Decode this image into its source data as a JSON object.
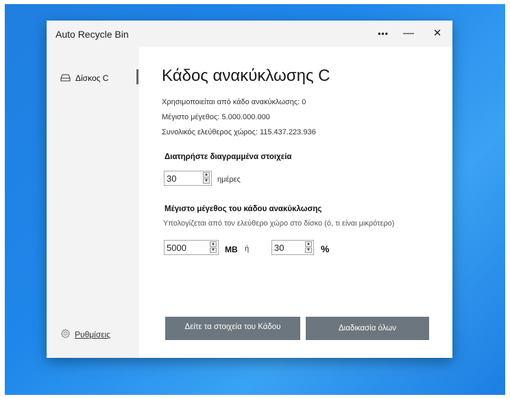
{
  "window": {
    "title": "Auto Recycle Bin",
    "controls": {
      "more": "•••",
      "minimize": "—",
      "close": "✕"
    }
  },
  "sidebar": {
    "items": [
      {
        "label": "Δίσκος C",
        "icon": "drive-icon",
        "selected": true
      }
    ],
    "settings_label": "Ρυθμίσεις",
    "settings_icon": "gear-icon"
  },
  "main": {
    "title": "Κάδος ανακύκλωσης C",
    "info": [
      "Χρησιμοποιείται από κάδο ανακύκλωσης: 0",
      "Μέγιστο μέγεθος: 5.000.000.000",
      "Συνολικός ελεύθερος χώρος: 115.437.223.936"
    ],
    "keep_section": {
      "heading": "Διατηρήστε διαγραμμένα στοιχεία",
      "value": "30",
      "unit": "ημέρες"
    },
    "max_size_section": {
      "heading": "Μέγιστο μέγεθος του κάδου ανακύκλωσης",
      "subtitle": "Υπολογίζεται από τον ελεύθερο χώρο στο δίσκο (ό, τι είναι μικρότερο)",
      "mb_value": "5000",
      "mb_unit": "MB",
      "or_text": "ή",
      "percent_value": "30",
      "percent_unit": "%"
    },
    "buttons": {
      "view_items": "Δείτε τα στοιχεία του Κάδου",
      "process_all": "Διαδικασία όλων"
    }
  }
}
